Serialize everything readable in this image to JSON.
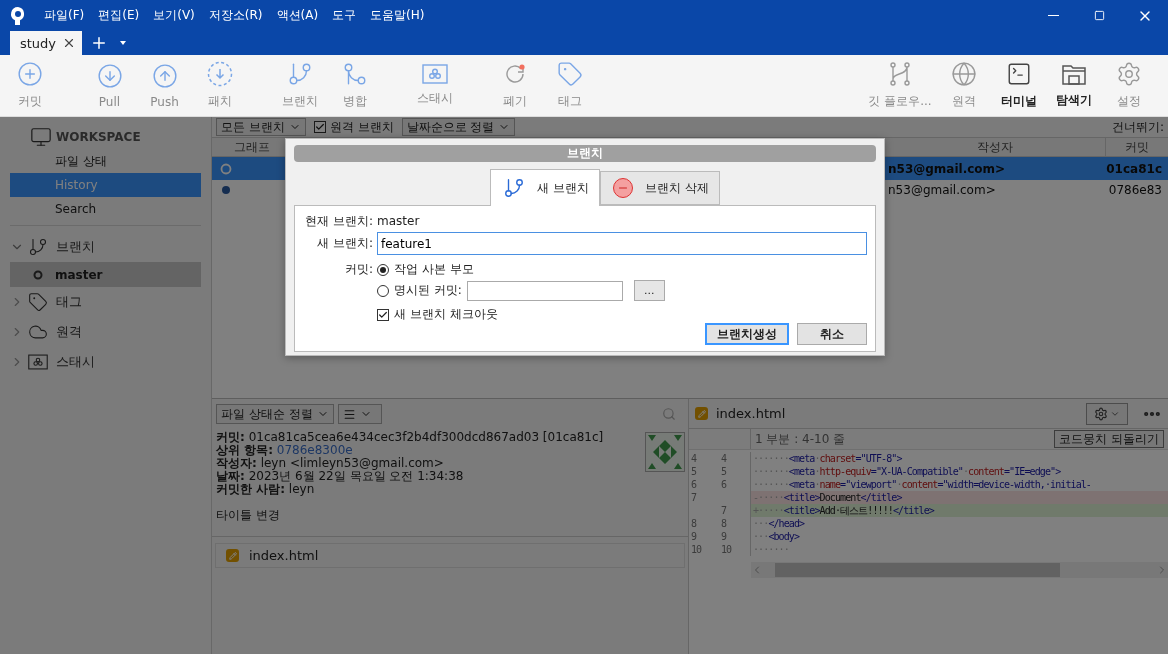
{
  "menu": [
    "파일(F)",
    "편집(E)",
    "보기(V)",
    "저장소(R)",
    "액션(A)",
    "도구",
    "도움말(H)"
  ],
  "tabs": [
    {
      "label": "study",
      "selected": true
    }
  ],
  "toolbar": {
    "left": [
      {
        "label": "커밋"
      },
      {
        "label": "Pull"
      },
      {
        "label": "Push"
      },
      {
        "label": "패치"
      },
      {
        "label": "브랜치"
      },
      {
        "label": "병합"
      },
      {
        "label": "스태시"
      },
      {
        "label": "폐기"
      },
      {
        "label": "태그"
      }
    ],
    "right": [
      {
        "label": "깃 플로우...",
        "disabled": true
      },
      {
        "label": "원격",
        "disabled": true
      },
      {
        "label": "터미널",
        "disabled": false
      },
      {
        "label": "탐색기",
        "disabled": false
      },
      {
        "label": "설정",
        "disabled": true
      }
    ]
  },
  "sidebar": {
    "workspace": {
      "title": "WORKSPACE",
      "items": [
        {
          "label": "파일 상태",
          "selected": false
        },
        {
          "label": "History",
          "selected": true
        },
        {
          "label": "Search",
          "selected": false
        }
      ]
    },
    "sections": [
      {
        "label": "브랜치",
        "expanded": true,
        "children": [
          {
            "label": "master",
            "selected": true
          }
        ]
      },
      {
        "label": "태그",
        "expanded": false
      },
      {
        "label": "원격",
        "expanded": false
      },
      {
        "label": "스태시",
        "expanded": false
      }
    ]
  },
  "history": {
    "branch_filter": "모든 브랜치",
    "remote_branches": {
      "label": "원격 브랜치",
      "checked": true
    },
    "sort": "날짜순으로 정렬",
    "jump_label": "건너뛰기:",
    "columns": [
      "그래프",
      "작성자",
      "커밋"
    ],
    "rows": [
      {
        "author": "n53@gmail.com>",
        "commit": "01ca81c",
        "selected": true
      },
      {
        "author": "n53@gmail.com>",
        "commit": "0786e83",
        "selected": false
      }
    ]
  },
  "details": {
    "sort": "파일 상태순 정렬",
    "lines": [
      {
        "label": "커밋:",
        "value": "01ca81ca5cea6e434cec3f2b4df300dcd867ad03 [01ca81c]",
        "kind": "text"
      },
      {
        "label": "상위 항목:",
        "value": "0786e8300e",
        "kind": "link"
      },
      {
        "label": "작성자:",
        "value": "leyn <limleyn53@gmail.com>",
        "kind": "text"
      },
      {
        "label": "날짜:",
        "value": "2023년 6월 22일 목요일 오전 1:34:38",
        "kind": "text"
      },
      {
        "label": "커밋한 사람:",
        "value": "leyn",
        "kind": "text"
      }
    ],
    "message": "타이틀 변경",
    "files": [
      "index.html"
    ]
  },
  "diff": {
    "file": "index.html",
    "hunk_title": "1 부분 : 4-10 줄",
    "hunk_button": "코드뭉치 되돌리기",
    "lines": [
      {
        "old": "4",
        "new": "4",
        "kind": "context",
        "tokens": [
          {
            "kind": "ws",
            "text": "·······"
          },
          {
            "kind": "tag",
            "text": "<meta"
          },
          {
            "kind": "ws",
            "text": "·"
          },
          {
            "kind": "attr",
            "text": "charset"
          },
          {
            "kind": "tag",
            "text": "="
          },
          {
            "kind": "val",
            "text": "\"UTF-8\""
          },
          {
            "kind": "tag",
            "text": ">"
          }
        ]
      },
      {
        "old": "5",
        "new": "5",
        "kind": "context",
        "tokens": [
          {
            "kind": "ws",
            "text": "·······"
          },
          {
            "kind": "tag",
            "text": "<meta"
          },
          {
            "kind": "ws",
            "text": "·"
          },
          {
            "kind": "attr",
            "text": "http-equiv"
          },
          {
            "kind": "tag",
            "text": "="
          },
          {
            "kind": "val",
            "text": "\"X-UA-Compatible\""
          },
          {
            "kind": "ws",
            "text": "·"
          },
          {
            "kind": "attr",
            "text": "content"
          },
          {
            "kind": "tag",
            "text": "="
          },
          {
            "kind": "val",
            "text": "\"IE=edge\""
          },
          {
            "kind": "tag",
            "text": ">"
          }
        ]
      },
      {
        "old": "6",
        "new": "6",
        "kind": "context",
        "tokens": [
          {
            "kind": "ws",
            "text": "·······"
          },
          {
            "kind": "tag",
            "text": "<meta"
          },
          {
            "kind": "ws",
            "text": "·"
          },
          {
            "kind": "attr",
            "text": "name"
          },
          {
            "kind": "tag",
            "text": "="
          },
          {
            "kind": "val",
            "text": "\"viewport\""
          },
          {
            "kind": "ws",
            "text": "·"
          },
          {
            "kind": "attr",
            "text": "content"
          },
          {
            "kind": "tag",
            "text": "="
          },
          {
            "kind": "val",
            "text": "\"width=device-width,·initial-"
          }
        ]
      },
      {
        "old": "7",
        "kind": "removed",
        "tokens": [
          {
            "kind": "ws",
            "text": "-·····"
          },
          {
            "kind": "tag",
            "text": "<title>"
          },
          {
            "kind": "text",
            "text": "Document"
          },
          {
            "kind": "tag",
            "text": "</title>"
          }
        ]
      },
      {
        "new": "7",
        "kind": "added",
        "tokens": [
          {
            "kind": "ws",
            "text": "+·····"
          },
          {
            "kind": "tag",
            "text": "<title>"
          },
          {
            "kind": "text",
            "text": "Add·테스트!!!!!"
          },
          {
            "kind": "tag",
            "text": "</title>"
          }
        ]
      },
      {
        "old": "8",
        "new": "8",
        "kind": "context",
        "tokens": [
          {
            "kind": "ws",
            "text": "···"
          },
          {
            "kind": "tag",
            "text": "</head>"
          }
        ]
      },
      {
        "old": "9",
        "new": "9",
        "kind": "context",
        "tokens": [
          {
            "kind": "ws",
            "text": "···"
          },
          {
            "kind": "tag",
            "text": "<body>"
          }
        ]
      },
      {
        "old": "10",
        "new": "10",
        "kind": "context",
        "tokens": [
          {
            "kind": "ws",
            "text": "·······"
          }
        ]
      }
    ]
  },
  "dialog": {
    "title": "브랜치",
    "tabs": [
      {
        "label": "새 브랜치",
        "selected": true
      },
      {
        "label": "브랜치 삭제",
        "selected": false
      }
    ],
    "current_branch_label": "현재 브랜치:",
    "current_branch": "master",
    "new_branch_label": "새 브랜치:",
    "new_branch_value": "feature1",
    "commit_label": "커밋:",
    "options": [
      {
        "label": "작업 사본 부모",
        "selected": true
      },
      {
        "label": "명시된 커밋:",
        "selected": false
      }
    ],
    "browse_button": "...",
    "checkout": {
      "label": "새 브랜치 체크아웃",
      "checked": true
    },
    "buttons": [
      {
        "label": "브랜치생성",
        "kind": "primary"
      },
      {
        "label": "취소",
        "kind": "secondary"
      }
    ]
  }
}
